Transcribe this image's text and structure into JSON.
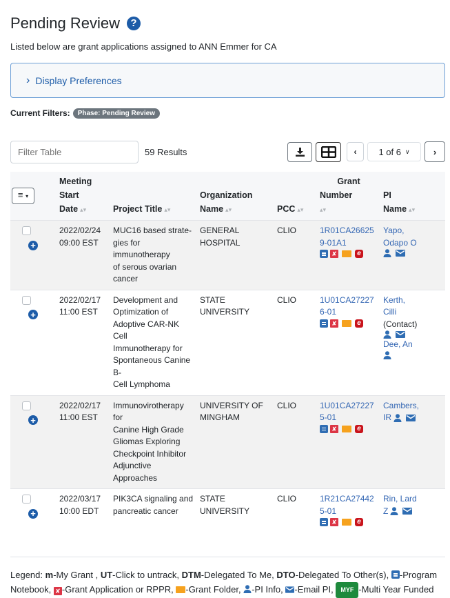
{
  "header": {
    "title": "Pending Review",
    "help_icon": "question-circle-icon",
    "intro": "Listed below are grant applications assigned to ANN Emmer for CA"
  },
  "preferences": {
    "label": "Display Preferences",
    "icon": "chevron-right-icon"
  },
  "filters": {
    "label": "Current Filters:",
    "active": [
      "Phase: Pending Review"
    ]
  },
  "toolbar": {
    "filter_placeholder": "Filter Table",
    "filter_value": "",
    "results": "59 Results",
    "download_icon": "download-icon",
    "columns_icon": "table-grid-icon",
    "prev_icon": "chevron-left-icon",
    "page_select": "1 of 6",
    "next_icon": "chevron-right-icon"
  },
  "table": {
    "menu_icon": "list-menu-icon",
    "columns": [
      {
        "label_lines": [
          "Meeting",
          "Start",
          "Date"
        ],
        "sortable": true
      },
      {
        "label_lines": [
          "Project Title"
        ],
        "sortable": true
      },
      {
        "label_lines": [
          "Organization",
          "Name"
        ],
        "sortable": true
      },
      {
        "label_lines": [
          "PCC"
        ],
        "sortable": true
      },
      {
        "label_lines": [
          "Grant",
          "Number"
        ],
        "sortable": true
      },
      {
        "label_lines": [
          "PI",
          "Name"
        ],
        "sortable": true
      }
    ],
    "rows": [
      {
        "date": "2022/02/24",
        "time": "09:00 EST",
        "title": "MUC16 based strate-gies for immunotherapy of serous ovarian cancer",
        "title_lines": [
          "MUC16 based strate-",
          "gies for immunotherapy",
          "of serous ovarian cancer"
        ],
        "org_lines": [
          "GENERAL",
          "HOSPITAL"
        ],
        "pcc": "CLIO",
        "grant_lines": [
          "1R01CA26625",
          "9-01A1"
        ],
        "pis": [
          {
            "name_lines": [
              "Yapo,",
              "Odapo O"
            ],
            "role": "",
            "info": true,
            "email": true
          }
        ]
      },
      {
        "date": "2022/02/17",
        "time": "11:00 EST",
        "title_lines": [
          "Development and",
          "Optimization of",
          "Adoptive CAR-NK Cell",
          "Immunotherapy for",
          "Spontaneous Canine B-",
          "Cell Lymphoma"
        ],
        "org_lines": [
          "STATE",
          "UNIVERSITY"
        ],
        "pcc": "CLIO",
        "grant_lines": [
          "1U01CA27227",
          "6-01"
        ],
        "pis": [
          {
            "name_lines": [
              "Kerth,",
              "Cilli"
            ],
            "role": "(Contact)",
            "info": true,
            "email": true
          },
          {
            "name_lines": [
              "Dee,  An"
            ],
            "role": "",
            "info": true,
            "email": false
          }
        ]
      },
      {
        "date": "2022/02/17",
        "time": "11:00 EST",
        "title_lines": [
          "Immunovirotherapy for",
          "Canine High Grade",
          "Gliomas Exploring",
          "Checkpoint Inhibitor",
          "Adjunctive Approaches"
        ],
        "org_lines": [
          "UNIVERSITY OF",
          "MINGHAM"
        ],
        "pcc": "CLIO",
        "grant_lines": [
          "1U01CA27227",
          "5-01"
        ],
        "pis": [
          {
            "name_lines": [
              "Cambers,",
              "IR"
            ],
            "role": "",
            "info": true,
            "email": true
          }
        ]
      },
      {
        "date": "2022/03/17",
        "time": "10:00 EDT",
        "title_lines": [
          "PIK3CA signaling and",
          "pancreatic cancer"
        ],
        "org_lines": [
          "STATE",
          "UNIVERSITY"
        ],
        "pcc": "CLIO",
        "grant_lines": [
          "1R21CA27442",
          "5-01"
        ],
        "pis": [
          {
            "name_lines": [
              "Rin, Lard",
              "Z"
            ],
            "role": "",
            "info": true,
            "email": true
          }
        ]
      }
    ],
    "row_icons": [
      "program-notebook-icon",
      "pdf-icon",
      "folder-icon",
      "eapp-icon"
    ]
  },
  "legend": {
    "prefix": "Legend:",
    "items": [
      {
        "key": "m",
        "text": "-My Grant ,"
      },
      {
        "key": "UT",
        "text": "-Click to untrack,"
      },
      {
        "key": "DTM",
        "text": "-Delegated To Me,"
      },
      {
        "key": "DTO",
        "text": "-Delegated To Other(s),"
      },
      {
        "icon": "program-notebook-icon",
        "text": "-Program Notebook,"
      },
      {
        "icon": "pdf-icon",
        "text": "-Grant Application or RPPR,"
      },
      {
        "icon": "folder-icon",
        "text": "-Grant Folder,"
      },
      {
        "icon": "person-icon",
        "text": "-PI Info,"
      },
      {
        "icon": "envelope-icon",
        "text": "-Email PI,"
      },
      {
        "badge": "MYF",
        "text": "-Multi Year Funded"
      }
    ]
  },
  "colors": {
    "primary": "#1d5ca8",
    "link": "#3366b3",
    "pdf": "#dc3545",
    "folder": "#f6a21e",
    "eapp": "#c9141c",
    "myf": "#1e8a3d",
    "pill": "#6c757d"
  }
}
